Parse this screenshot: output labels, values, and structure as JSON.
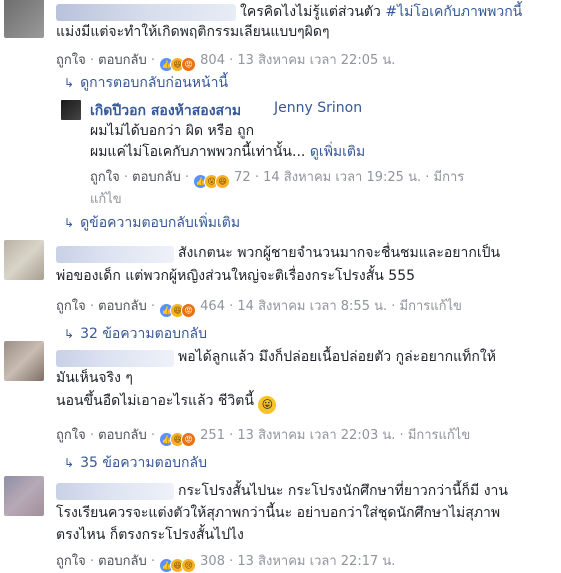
{
  "comment1": {
    "text_line1_a": "ใครคิดไงไม่รู้แต่ส่วนตัว ",
    "text_line1_tag": "#ไม่โอเคกับภาพพวกนี้",
    "text_line2": "แม่งมีแต่จะทำให้เกิดพฤติกรรมเลียนแบบๆผิดๆ",
    "like_label": "ถูกใจ",
    "reply_label": "ตอบกลับ",
    "reaction_count": "804",
    "timestamp": "13 สิงหาคม เวลา 22:05 น.",
    "prev_replies": "ดูการตอบกลับก่อนหน้านี้"
  },
  "reply1": {
    "author": "เกิดปีวอก สองห้าสองสาม",
    "mention": "Jenny Srinon",
    "line1": "ผมไม่ได้บอกว่า ผิด หรือ ถูก",
    "line2": "ผมแค่ไม่โอเคกับภาพพวกนี้เท่านั้น...",
    "see_more": "ดูเพิ่มเติม",
    "like_label": "ถูกใจ",
    "reply_label": "ตอบกลับ",
    "reaction_count": "72",
    "timestamp": "14 สิงหาคม เวลา 19:25 น.",
    "edited_a": "มีการ",
    "edited_b": "แก้ไข",
    "more_replies": "ดูข้อความตอบกลับเพิ่มเติม"
  },
  "comment2": {
    "line1": "สังเกตนะ พวกผู้ชายจำนวนมากจะชื่นชมและอยากเป็น",
    "line2": "พ่อของเด็ก แต่พวกผู้หญิงส่วนใหญ่จะติเรื่องกระโปรงสั้น 555",
    "like_label": "ถูกใจ",
    "reply_label": "ตอบกลับ",
    "reaction_count": "464",
    "timestamp": "14 สิงหาคม เวลา 8:55 น.",
    "edited": "มีการแก้ไข",
    "replies": "32 ข้อความตอบกลับ"
  },
  "comment3": {
    "line1": "พอได้ลูกแล้ว มึงก็ปล่อยเนื้อปล่อยตัว กูล่ะอยากแท็กให้",
    "line2": "มันเห็นจริง ๆ",
    "line3": "นอนขึ้นอืดไม่เอาอะไรแล้ว ชีวิตนี้ ",
    "emoji": "😛",
    "like_label": "ถูกใจ",
    "reply_label": "ตอบกลับ",
    "reaction_count": "251",
    "timestamp": "13 สิงหาคม เวลา 22:03 น.",
    "edited": "มีการแก้ไข",
    "replies": "35 ข้อความตอบกลับ"
  },
  "comment4": {
    "line1": "กระโปรงสั้นไปนะ กระโปรงนักศึกษาที่ยาวกว่านี้ก็มี งาน",
    "line2": "โรงเรียนควรจะแต่งตัวให้สุภาพกว่านี้นะ อย่าบอกว่าใส่ชุดนักศึกษาไม่สุภาพ",
    "line3": "ตรงไหน ก็ตรงกระโปรงสั้นไปไง",
    "like_label": "ถูกใจ",
    "reply_label": "ตอบกลับ",
    "reaction_count": "308",
    "timestamp": "13 สิงหาคม เวลา 22:17 น."
  },
  "sep": "·",
  "icons": {
    "like": "thumbs-up-icon",
    "haha": "laughing-face-icon",
    "angry": "angry-face-icon",
    "wow": "wow-face-icon",
    "sad": "sad-face-icon",
    "love": "heart-icon",
    "reply_arrow": "reply-arrow-icon"
  },
  "colors": {
    "link": "#365899",
    "meta": "#90949c",
    "text": "#1d2129",
    "like": "#5890ff"
  }
}
